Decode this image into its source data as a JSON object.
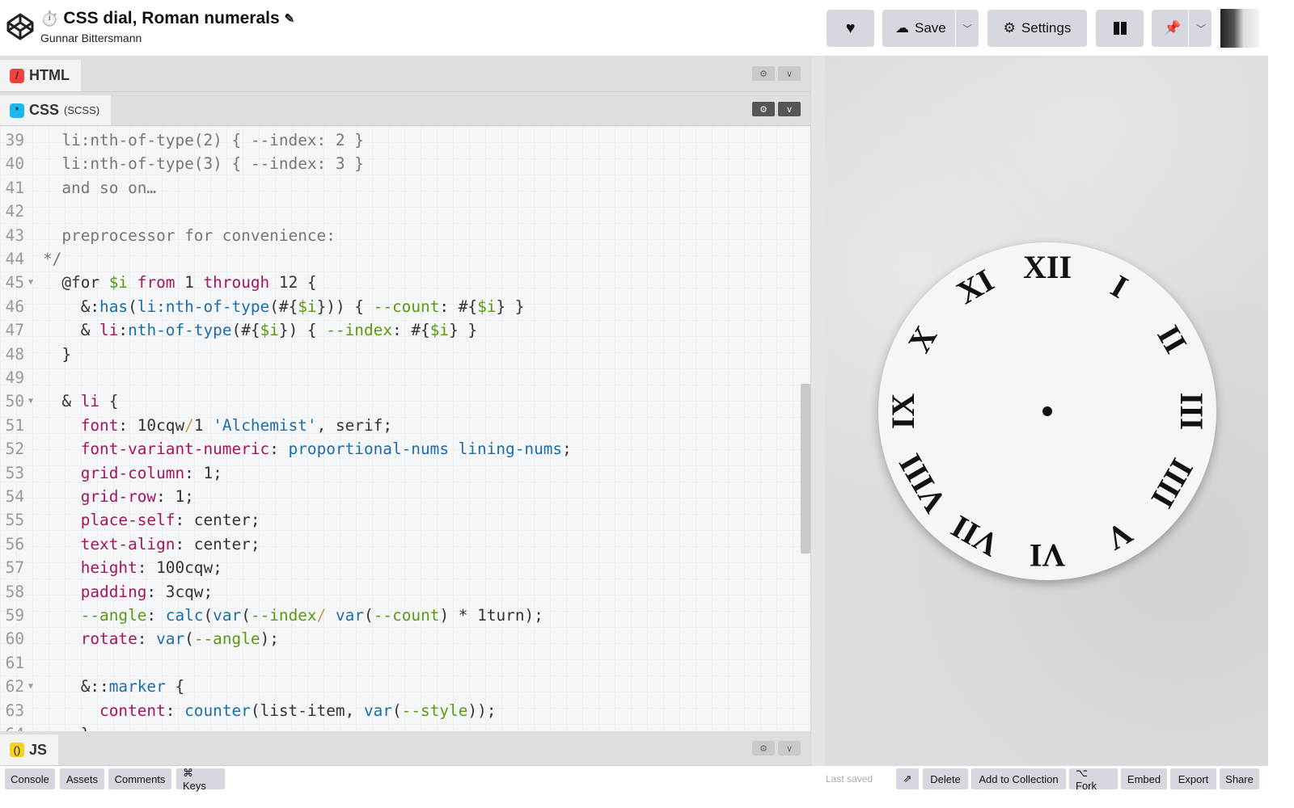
{
  "header": {
    "title": "CSS dial, Roman numerals",
    "title_emoji": "⏱️",
    "edit_icon": "pencil-icon",
    "author": "Gunnar Bittersmann",
    "buttons": {
      "heart": "heart-icon",
      "save": "Save",
      "settings": "Settings",
      "layout": "layout-icon",
      "pin": "pin-icon"
    }
  },
  "editors": {
    "html": {
      "label": "HTML"
    },
    "css": {
      "label": "CSS",
      "sub": "(SCSS)"
    },
    "js": {
      "label": "JS"
    }
  },
  "code": {
    "lines": [
      {
        "n": "39",
        "t": [
          [
            "c",
            "  li:nth-of-type(2) { --index: 2 }"
          ]
        ]
      },
      {
        "n": "40",
        "t": [
          [
            "c",
            "  li:nth-of-type(3) { --index: 3 }"
          ]
        ]
      },
      {
        "n": "41",
        "t": [
          [
            "c",
            "  and so on…"
          ]
        ]
      },
      {
        "n": "42",
        "t": []
      },
      {
        "n": "43",
        "t": [
          [
            "c",
            "  preprocessor for convenience:"
          ]
        ]
      },
      {
        "n": "44",
        "t": [
          [
            "c",
            "*/"
          ]
        ]
      },
      {
        "n": "45",
        "f": true,
        "t": [
          [
            "",
            "  @for "
          ],
          [
            "g",
            "$i"
          ],
          [
            "k",
            " from "
          ],
          [
            "",
            "1 "
          ],
          [
            "k",
            "through"
          ],
          [
            "",
            " 12 {"
          ]
        ]
      },
      {
        "n": "46",
        "t": [
          [
            "",
            "    &:"
          ],
          [
            "v",
            "has"
          ],
          [
            "",
            "("
          ],
          [
            "v",
            "li:nth-of-type"
          ],
          [
            "",
            "(#{"
          ],
          [
            "g",
            "$i"
          ],
          [
            "",
            "})) { "
          ],
          [
            "g",
            "--count"
          ],
          [
            "",
            ": #{"
          ],
          [
            "g",
            "$i"
          ],
          [
            "",
            "} }"
          ]
        ]
      },
      {
        "n": "47",
        "t": [
          [
            "",
            "    & "
          ],
          [
            "k",
            "li"
          ],
          [
            "",
            ":"
          ],
          [
            "v",
            "nth-of-type"
          ],
          [
            "",
            "(#{"
          ],
          [
            "g",
            "$i"
          ],
          [
            "",
            "}) { "
          ],
          [
            "g",
            "--index"
          ],
          [
            "",
            ": #{"
          ],
          [
            "g",
            "$i"
          ],
          [
            "",
            "} }"
          ]
        ]
      },
      {
        "n": "48",
        "t": [
          [
            "",
            "  }"
          ]
        ]
      },
      {
        "n": "49",
        "t": []
      },
      {
        "n": "50",
        "f": true,
        "t": [
          [
            "",
            "  & "
          ],
          [
            "k",
            "li"
          ],
          [
            "",
            " {"
          ]
        ]
      },
      {
        "n": "51",
        "t": [
          [
            "k",
            "    font"
          ],
          [
            "",
            ": 10cqw"
          ],
          [
            "o",
            "/"
          ],
          [
            "",
            "1 "
          ],
          [
            "v",
            "'Alchemist'"
          ],
          [
            "",
            ", serif;"
          ]
        ]
      },
      {
        "n": "52",
        "t": [
          [
            "k",
            "    font-variant-numeric"
          ],
          [
            "",
            ": "
          ],
          [
            "v",
            "proportional-nums lining-nums"
          ],
          [
            "",
            ";"
          ]
        ]
      },
      {
        "n": "53",
        "t": [
          [
            "k",
            "    grid-column"
          ],
          [
            "",
            ": 1;"
          ]
        ]
      },
      {
        "n": "54",
        "t": [
          [
            "k",
            "    grid-row"
          ],
          [
            "",
            ": 1;"
          ]
        ]
      },
      {
        "n": "55",
        "t": [
          [
            "k",
            "    place-self"
          ],
          [
            "",
            ": center;"
          ]
        ]
      },
      {
        "n": "56",
        "t": [
          [
            "k",
            "    text-align"
          ],
          [
            "",
            ": center;"
          ]
        ]
      },
      {
        "n": "57",
        "t": [
          [
            "k",
            "    height"
          ],
          [
            "",
            ": 100cqw;"
          ]
        ]
      },
      {
        "n": "58",
        "t": [
          [
            "k",
            "    padding"
          ],
          [
            "",
            ": 3cqw;"
          ]
        ]
      },
      {
        "n": "59",
        "t": [
          [
            "g",
            "    --angle"
          ],
          [
            "",
            ": "
          ],
          [
            "v",
            "calc"
          ],
          [
            "",
            "("
          ],
          [
            "v",
            "var"
          ],
          [
            "",
            "("
          ],
          [
            "g",
            "--index"
          ],
          [
            ") "
          ],
          [
            "o",
            "/"
          ],
          [
            "",
            " "
          ],
          [
            "v",
            "var"
          ],
          [
            "",
            "("
          ],
          [
            "g",
            "--count"
          ],
          [
            "",
            ") * 1turn);"
          ]
        ]
      },
      {
        "n": "60",
        "t": [
          [
            "k",
            "    rotate"
          ],
          [
            "",
            ": "
          ],
          [
            "v",
            "var"
          ],
          [
            "",
            "("
          ],
          [
            "g",
            "--angle"
          ],
          [
            "",
            ");"
          ]
        ]
      },
      {
        "n": "61",
        "t": []
      },
      {
        "n": "62",
        "f": true,
        "t": [
          [
            "",
            "    &::"
          ],
          [
            "v",
            "marker"
          ],
          [
            "",
            " {"
          ]
        ]
      },
      {
        "n": "63",
        "t": [
          [
            "k",
            "      content"
          ],
          [
            "",
            ": "
          ],
          [
            "v",
            "counter"
          ],
          [
            "",
            "(list-item, "
          ],
          [
            "v",
            "var"
          ],
          [
            "",
            "("
          ],
          [
            "g",
            "--style"
          ],
          [
            "",
            "));"
          ]
        ]
      },
      {
        "n": "64",
        "t": [
          [
            "",
            "    }"
          ]
        ]
      }
    ]
  },
  "preview": {
    "numerals": [
      "XII",
      "I",
      "II",
      "III",
      "IIII",
      "V",
      "VI",
      "VII",
      "VIII",
      "IX",
      "X",
      "XI"
    ]
  },
  "footer": {
    "left": [
      "Console",
      "Assets",
      "Comments",
      "⌘ Keys"
    ],
    "last_saved": "Last saved",
    "right": [
      "Delete",
      "Add to Collection",
      "⌥ Fork",
      "Embed",
      "Export",
      "Share"
    ]
  },
  "colors": {
    "keyword": "#a3155c",
    "value": "#1c6ea4",
    "variable": "#5a9a12",
    "html_badge": "#f04040",
    "css_badge": "#1ab8ee",
    "js_badge": "#f7d21c"
  }
}
